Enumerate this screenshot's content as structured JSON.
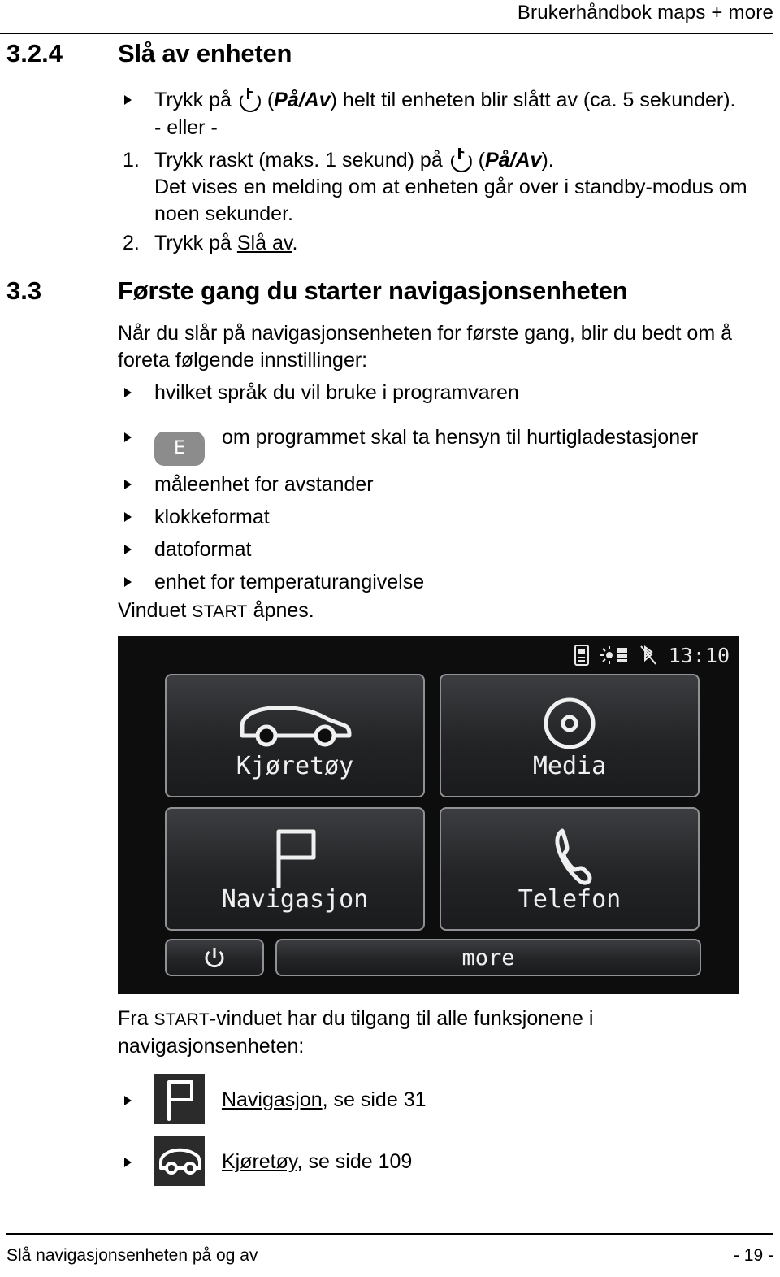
{
  "header": {
    "title": "Brukerhåndbok maps + more"
  },
  "footer": {
    "left": "Slå navigasjonsenheten på og av",
    "right": "- 19 -"
  },
  "sections": [
    {
      "number": "3.2.4",
      "title": "Slå av enheten",
      "bullet1_pre": "Trykk på",
      "bullet1_icon": "power-icon",
      "bullet1_post_open": "(",
      "bullet1_italic": "På/Av",
      "bullet1_post": ") helt til enheten blir slått av (ca. 5 sekunder).",
      "or_text": "- eller -",
      "step1_num": "1.",
      "step1_text": "Trykk raskt (maks. 1 sekund) på",
      "step1_italic": "På/Av",
      "step1_tail": ").",
      "step1_body": "Det vises en melding om at enheten går over i standby-modus om noen sekunder.",
      "step2_num": "2.",
      "step2_text": "Trykk på ",
      "step2_underlined": "Slå av",
      "step2_tail": "."
    },
    {
      "number": "3.3",
      "title": "Første gang du starter navigasjonsenheten",
      "intro": "Når du slår på navigasjonsenheten for første gang, blir du bedt om å foreta følgende innstillinger:",
      "items": [
        {
          "text": "hvilket språk du vil bruke i programvaren",
          "icon": null
        },
        {
          "text": "om programmet skal ta hensyn til hurtigladestasjoner",
          "icon": "e-badge",
          "icon_label": "E"
        },
        {
          "text": "måleenhet for avstander",
          "icon": null
        },
        {
          "text": "klokkeformat",
          "icon": null
        },
        {
          "text": "datoformat",
          "icon": null
        },
        {
          "text": "enhet for temperaturangivelse",
          "icon": null
        }
      ],
      "after_items_pre": "Vinduet ",
      "after_items_sc": "START",
      "after_items_post": " åpnes.",
      "after_image_pre": "Fra ",
      "after_image_sc": "START",
      "after_image_post": "-vinduet har du tilgang til alle funksjonene i navigasjonsenheten:",
      "links": [
        {
          "icon": "flag-icon",
          "label": "Navigasjon",
          "tail": ", se side 31"
        },
        {
          "icon": "car-icon",
          "label": "Kjøretøy",
          "tail": ", se side 109"
        }
      ]
    }
  ],
  "device_screen": {
    "clock": "13:10",
    "status_icons": [
      "sim-card-icon",
      "brightness-icon",
      "bluetooth-off-icon"
    ],
    "tiles": [
      {
        "label": "Kjøretøy",
        "icon": "car-icon"
      },
      {
        "label": "Media",
        "icon": "disc-icon"
      },
      {
        "label": "Navigasjon",
        "icon": "flag-icon"
      },
      {
        "label": "Telefon",
        "icon": "phone-icon"
      }
    ],
    "bottom": {
      "power_icon": "power-icon",
      "more_label": "more"
    }
  }
}
